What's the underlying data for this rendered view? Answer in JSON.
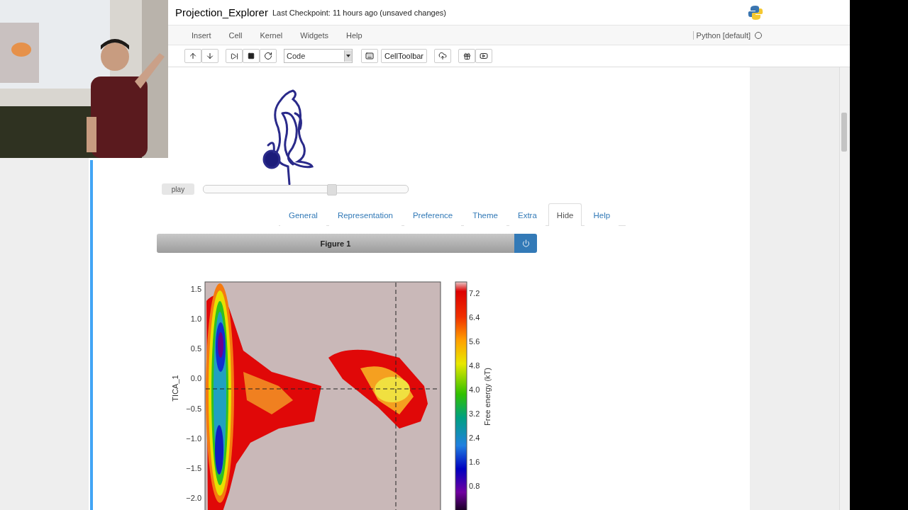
{
  "header": {
    "notebook_name": "Projection_Explorer",
    "checkpoint": "Last Checkpoint: 11 hours ago (unsaved changes)"
  },
  "menu": [
    "Insert",
    "Cell",
    "Kernel",
    "Widgets",
    "Help"
  ],
  "kernel": {
    "name": "Python [default]",
    "busy": false
  },
  "toolbar": {
    "cell_type": "Code",
    "celltoolbar": "CellToolbar"
  },
  "player": {
    "button": "play",
    "level": 0.63
  },
  "tabs": [
    {
      "label": "General",
      "selected": false
    },
    {
      "label": "Representation",
      "selected": false
    },
    {
      "label": "Preference",
      "selected": false
    },
    {
      "label": "Theme",
      "selected": false
    },
    {
      "label": "Extra",
      "selected": false
    },
    {
      "label": "Hide",
      "selected": true
    },
    {
      "label": "Help",
      "selected": false
    }
  ],
  "figure": {
    "title": "Figure 1"
  },
  "plot": {
    "ylabel": "TICA_1",
    "yticks": [
      "1.5",
      "1.0",
      "0.5",
      "0.0",
      "−0.5",
      "−1.0",
      "−1.5",
      "−2.0"
    ],
    "colorbar_label": "Free energy (kT)",
    "colorbar_ticks": [
      "7.2",
      "6.4",
      "5.6",
      "4.8",
      "4.0",
      "3.2",
      "2.4",
      "1.6",
      "0.8"
    ]
  }
}
